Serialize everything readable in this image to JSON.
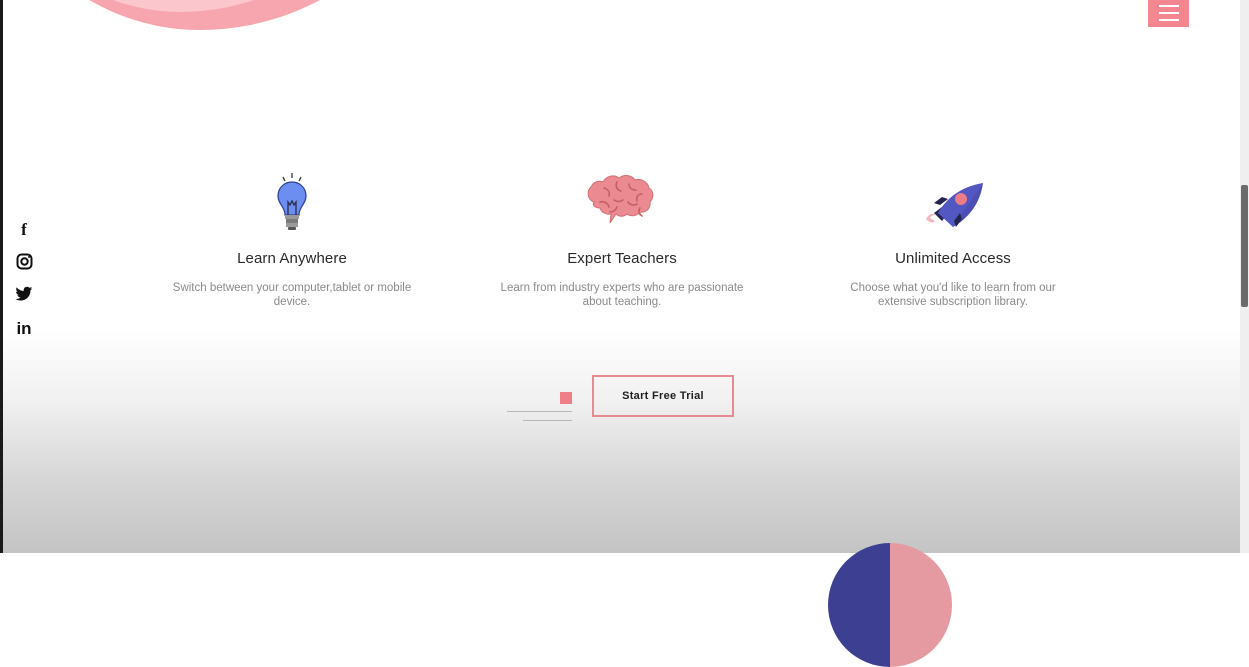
{
  "header": {
    "menu_icon": "hamburger-menu-icon",
    "accent_color": "#f4868f"
  },
  "social": [
    {
      "name": "facebook",
      "glyph": "f",
      "icon": "facebook-icon"
    },
    {
      "name": "instagram",
      "glyph": "",
      "icon": "instagram-icon"
    },
    {
      "name": "twitter",
      "glyph": "",
      "icon": "twitter-icon"
    },
    {
      "name": "linkedin",
      "glyph": "in",
      "icon": "linkedin-icon"
    }
  ],
  "features": [
    {
      "icon": "lightbulb-icon",
      "title": "Learn Anywhere",
      "description": "Switch between your computer,tablet or mobile device."
    },
    {
      "icon": "brain-icon",
      "title": "Expert Teachers",
      "description": "Learn from industry experts who are passionate about teaching."
    },
    {
      "icon": "rocket-icon",
      "title": "Unlimited Access",
      "description": "Choose what you'd like to learn from our extensive subscription library."
    }
  ],
  "cta": {
    "label": "Start Free Trial",
    "border_color": "#e98a92"
  },
  "colors": {
    "pink": "#f4868f",
    "navy": "#3d3f93",
    "text_dark": "#2a2a2a",
    "text_muted": "#8a8a8a"
  }
}
